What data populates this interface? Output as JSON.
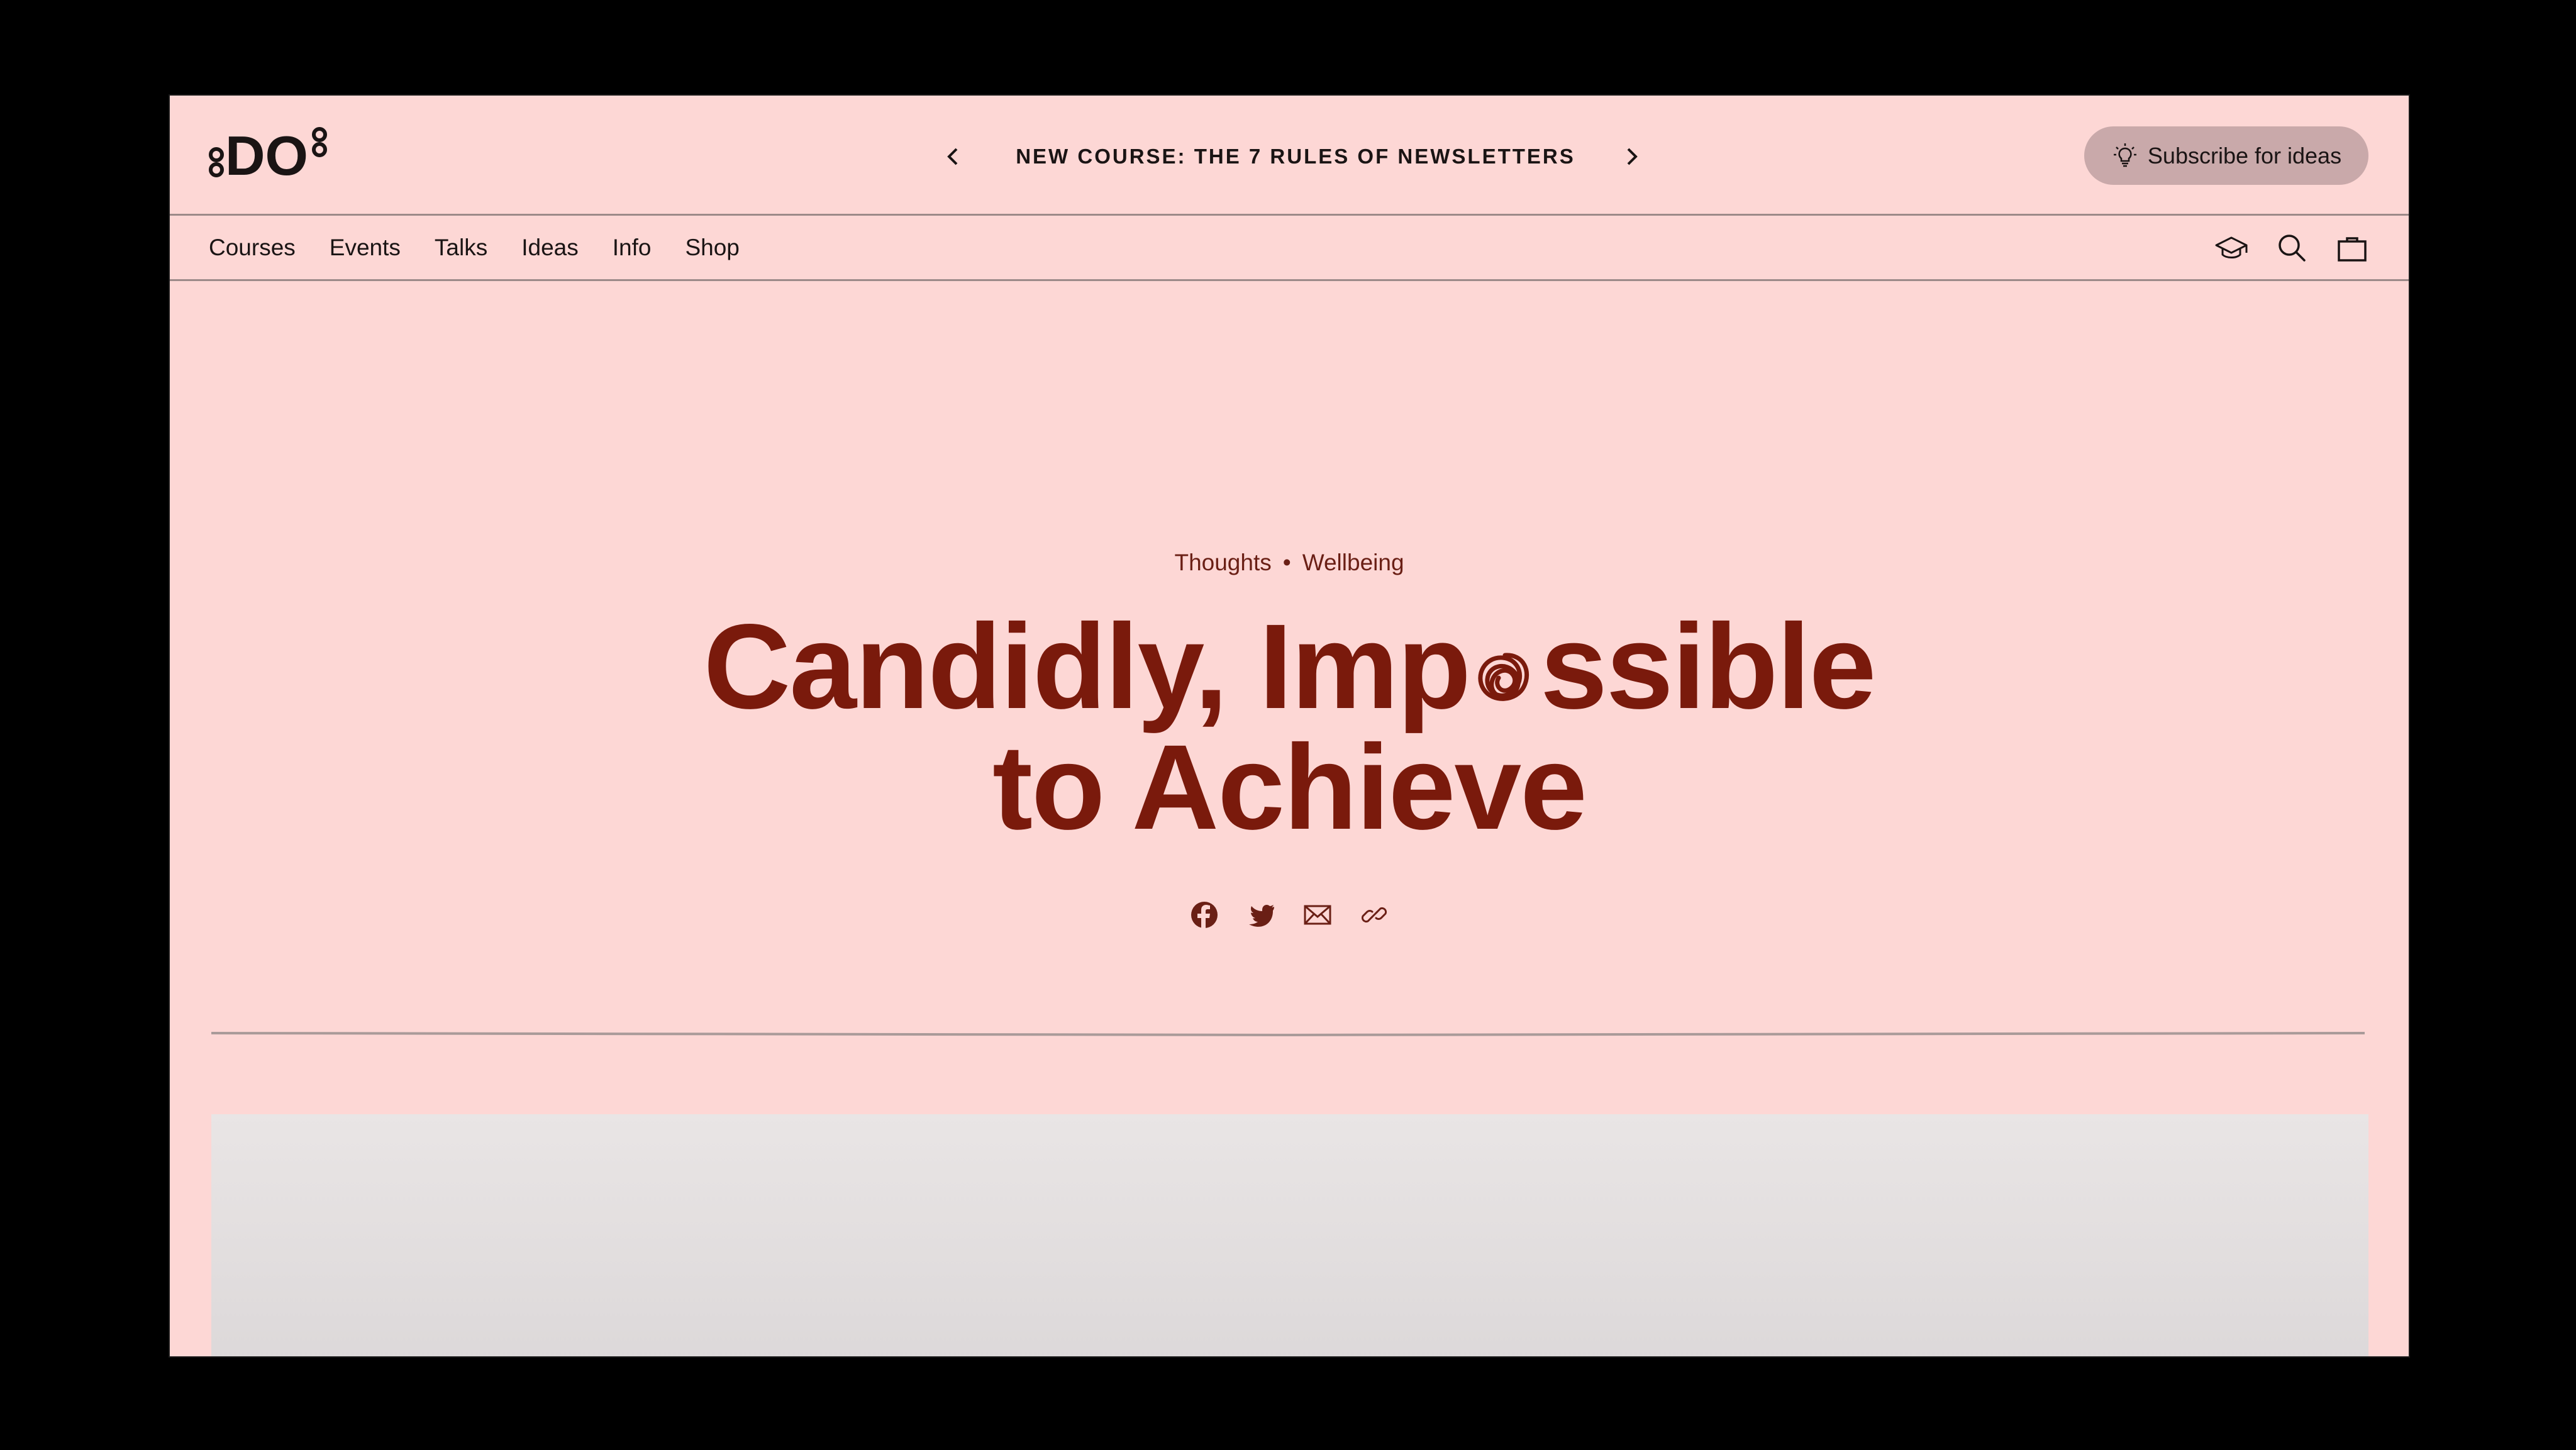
{
  "header": {
    "logo_text": "DO",
    "announcement": "NEW COURSE: THE 7 RULES OF NEWSLETTERS",
    "subscribe_label": "Subscribe for ideas",
    "icons": [
      "chevron-left-icon",
      "chevron-right-icon",
      "lightbulb-icon"
    ]
  },
  "nav": {
    "items": [
      {
        "label": "Courses"
      },
      {
        "label": "Events"
      },
      {
        "label": "Talks"
      },
      {
        "label": "Ideas"
      },
      {
        "label": "Info"
      },
      {
        "label": "Shop"
      }
    ],
    "icons": [
      "graduation-cap-icon",
      "search-icon",
      "shopping-bag-icon"
    ]
  },
  "article": {
    "tags": [
      "Thoughts",
      "Wellbeing"
    ],
    "title_part1": "Candidly, Imp",
    "title_part2": "ssible",
    "title_line2": "to Achieve",
    "share_icons": [
      "facebook-icon",
      "twitter-icon",
      "email-icon",
      "link-icon"
    ]
  },
  "colors": {
    "background": "#fdd7d5",
    "title": "#7a1a0c",
    "tag_text": "#6a1f15",
    "subscribe_bg": "#c9a9aa",
    "text_dark": "#1a1414"
  }
}
